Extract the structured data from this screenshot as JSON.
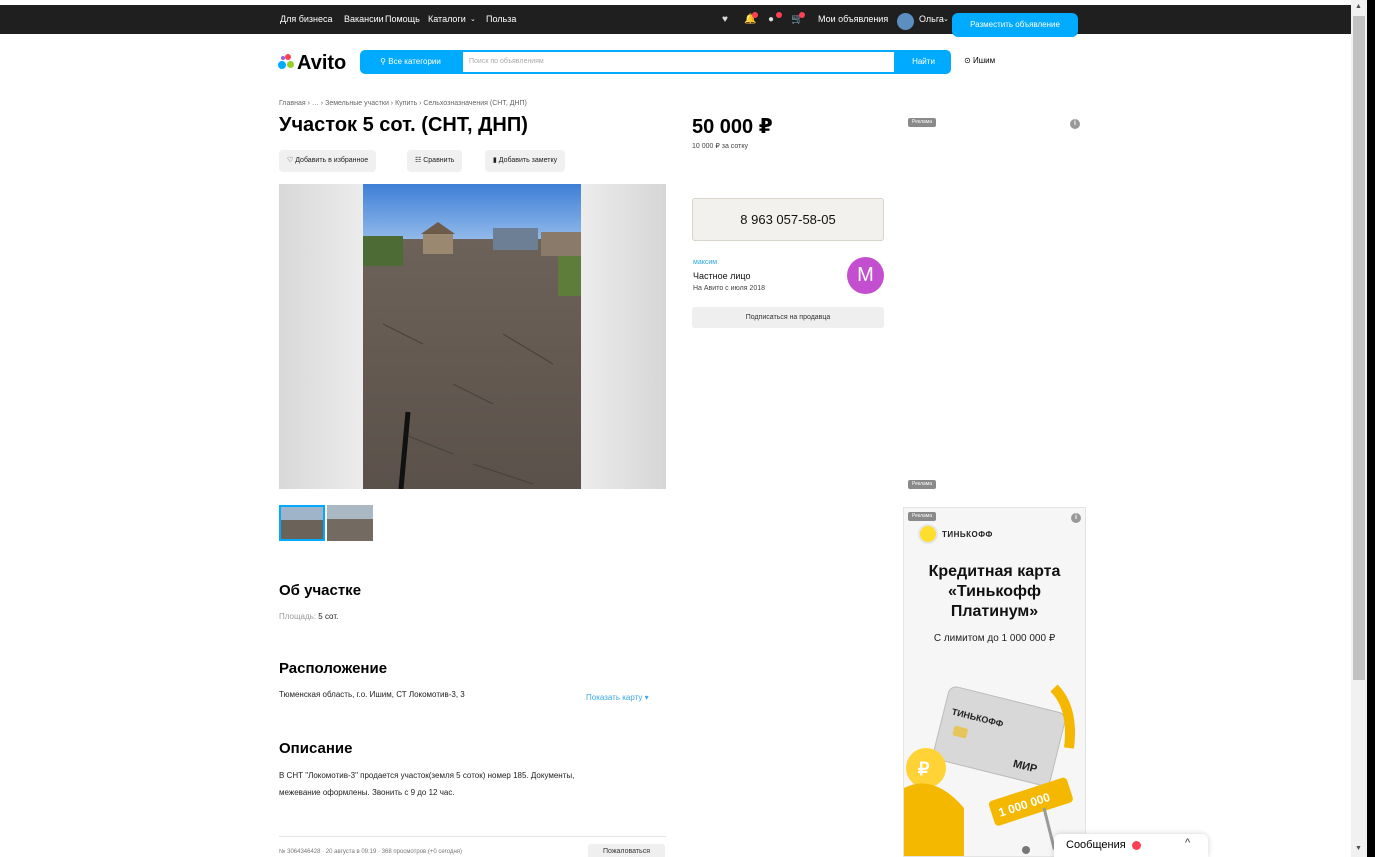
{
  "topbar": {
    "links": [
      "Для бизнеса",
      "Вакансии",
      "Помощь",
      "Каталоги",
      "Польза"
    ],
    "my_ads": "Мои объявления",
    "user": "Ольга",
    "post_ad": "Разместить объявление"
  },
  "search": {
    "logo": "Avito",
    "categories": "Все категории",
    "placeholder": "Поиск по объявлениям",
    "find": "Найти",
    "location": "Ишим"
  },
  "listing": {
    "breadcrumb": "Главная › … › Земельные участки › Купить › Сельхозназначения (СНТ, ДНП)",
    "title": "Участок 5 сот. (СНТ, ДНП)",
    "actions": {
      "favorite": "Добавить в избранное",
      "compare": "Сравнить",
      "note": "Добавить заметку"
    },
    "about_title": "Об участке",
    "area_label": "Площадь:",
    "area_value": "5 сот.",
    "location_title": "Расположение",
    "address": "Тюменская область, г.о. Ишим, СТ Локомотив-3, 3",
    "show_map": "Показать карту",
    "description_title": "Описание",
    "description_line1": "В СНТ \"Локомотив-3\" продается участок(земля 5 соток) номер 185. Документы,",
    "description_line2": "межевание оформлены. Звонить с 9 до 12 час.",
    "meta": "№ 3064346428 · 20 августа в 09:19 · 368 просмотров (+0 сегодня)",
    "complain": "Пожаловаться"
  },
  "sidebar": {
    "price": "50 000 ₽",
    "price_per": "10 000 ₽ за сотку",
    "phone": "8 963 057-58-05",
    "seller_name": "максим",
    "seller_type": "Частное лицо",
    "seller_since": "На Авито с июля 2018",
    "avatar_letter": "М",
    "subscribe": "Подписаться на продавца"
  },
  "ads": {
    "tag": "Реклама",
    "info_glyph": "i",
    "brand": "ТИНЬКОФФ",
    "headline_1": "Кредитная карта",
    "headline_2": "«Тинькофф",
    "headline_3": "Платинум»",
    "limit": "С лимитом до 1 000 000 ₽",
    "card_brand": "ТИНЬКОФФ",
    "coin_text": "1 000 000",
    "coin_symbol": "₽"
  },
  "messenger": {
    "label": "Сообщения",
    "chevron": "^"
  },
  "icons": {
    "favorites": "heart-icon",
    "notifications": "bell-icon",
    "messages": "chat-icon",
    "cart": "cart-icon",
    "location": "pin-icon",
    "search": "search-icon"
  },
  "colors": {
    "accent": "#00aaff",
    "topbar": "#1f1f1f",
    "badge": "#ff4053",
    "avatar": "#c34fd0"
  }
}
